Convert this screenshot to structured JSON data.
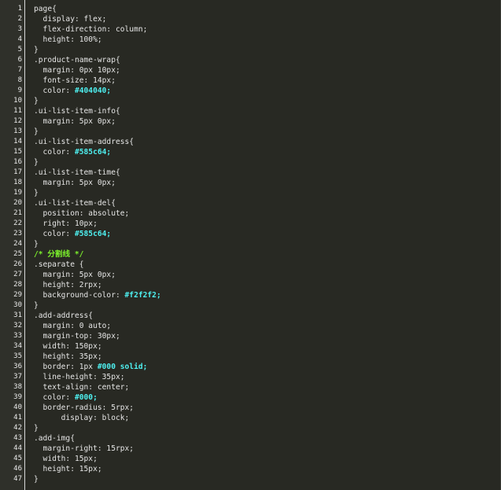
{
  "lines": [
    {
      "n": "1",
      "text": "page{"
    },
    {
      "n": "2",
      "text": "  display: flex;"
    },
    {
      "n": "3",
      "text": "  flex-direction: column;"
    },
    {
      "n": "4",
      "text": "  height: 100%;"
    },
    {
      "n": "5",
      "text": "}"
    },
    {
      "n": "6",
      "text": ".product-name-wrap{"
    },
    {
      "n": "7",
      "text": "  margin: 0px 10px;"
    },
    {
      "n": "8",
      "text": "  font-size: 14px;"
    },
    {
      "n": "9",
      "text": "  color: ",
      "hl": "#404040;"
    },
    {
      "n": "10",
      "text": "}"
    },
    {
      "n": "11",
      "text": ".ui-list-item-info{"
    },
    {
      "n": "12",
      "text": "  margin: 5px 0px;"
    },
    {
      "n": "13",
      "text": "}"
    },
    {
      "n": "14",
      "text": ".ui-list-item-address{"
    },
    {
      "n": "15",
      "text": "  color: ",
      "hl": "#585c64;"
    },
    {
      "n": "16",
      "text": "}"
    },
    {
      "n": "17",
      "text": ".ui-list-item-time{"
    },
    {
      "n": "18",
      "text": "  margin: 5px 0px;"
    },
    {
      "n": "19",
      "text": "}"
    },
    {
      "n": "20",
      "text": ".ui-list-item-del{"
    },
    {
      "n": "21",
      "text": "  position: absolute;"
    },
    {
      "n": "22",
      "text": "  right: 10px;"
    },
    {
      "n": "23",
      "text": "  color: ",
      "hl": "#585c64;"
    },
    {
      "n": "24",
      "text": "}"
    },
    {
      "n": "25",
      "text": "",
      "comment": "/* 分割线 */"
    },
    {
      "n": "26",
      "text": ".separate {"
    },
    {
      "n": "27",
      "text": "  margin: 5px 0px;"
    },
    {
      "n": "28",
      "text": "  height: 2rpx;"
    },
    {
      "n": "29",
      "text": "  background-color: ",
      "hl": "#f2f2f2;"
    },
    {
      "n": "30",
      "text": "}"
    },
    {
      "n": "31",
      "text": ".add-address{"
    },
    {
      "n": "32",
      "text": "  margin: 0 auto;"
    },
    {
      "n": "33",
      "text": "  margin-top: 30px;"
    },
    {
      "n": "34",
      "text": "  width: 150px;"
    },
    {
      "n": "35",
      "text": "  height: 35px;"
    },
    {
      "n": "36",
      "text": "  border: 1px ",
      "hl": "#000 solid;"
    },
    {
      "n": "37",
      "text": "  line-height: 35px;"
    },
    {
      "n": "38",
      "text": "  text-align: center;"
    },
    {
      "n": "39",
      "text": "  color: ",
      "hl": "#000;"
    },
    {
      "n": "40",
      "text": "  border-radius: 5rpx;"
    },
    {
      "n": "41",
      "text": "      display: block;"
    },
    {
      "n": "42",
      "text": "}"
    },
    {
      "n": "43",
      "text": ".add-img{"
    },
    {
      "n": "44",
      "text": "  margin-right: 15rpx;"
    },
    {
      "n": "45",
      "text": "  width: 15px;"
    },
    {
      "n": "46",
      "text": "  height: 15px;"
    },
    {
      "n": "47",
      "text": "}"
    }
  ]
}
